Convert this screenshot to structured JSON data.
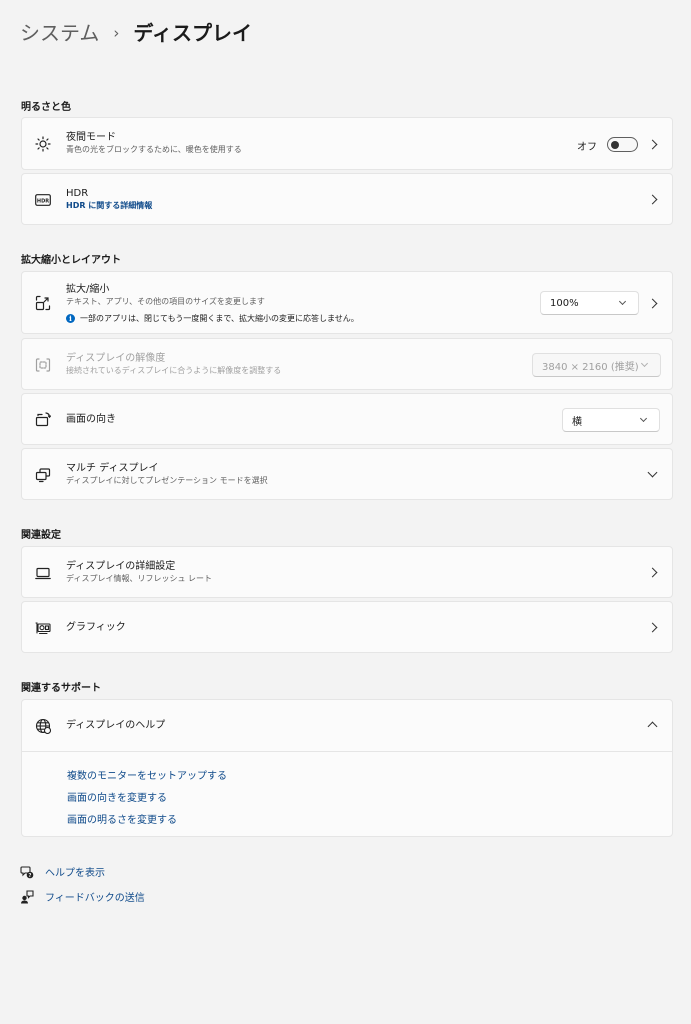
{
  "breadcrumb": {
    "parent": "システム",
    "separator": "›",
    "current": "ディスプレイ"
  },
  "sections": {
    "brightness": "明るさと色",
    "scale_layout": "拡大縮小とレイアウト",
    "related": "関連設定",
    "support": "関連するサポート"
  },
  "night_light": {
    "icon": "sun-icon",
    "title": "夜間モード",
    "subtitle": "青色の光をブロックするために、暖色を使用する",
    "state": "オフ",
    "on": false
  },
  "hdr": {
    "icon": "hdr-icon",
    "title": "HDR",
    "link": "HDR に関する詳細情報"
  },
  "scale": {
    "icon": "scale-icon",
    "title": "拡大/縮小",
    "subtitle": "テキスト、アプリ、その他の項目のサイズを変更します",
    "value": "100%",
    "info": "一部のアプリは、閉じてもう一度開くまで、拡大縮小の変更に応答しません。"
  },
  "resolution": {
    "icon": "resolution-icon",
    "title": "ディスプレイの解像度",
    "subtitle": "接続されているディスプレイに合うように解像度を調整する",
    "value": "3840 × 2160 (推奨)"
  },
  "orientation": {
    "icon": "orientation-icon",
    "title": "画面の向き",
    "value": "横"
  },
  "multi_display": {
    "icon": "multi-display-icon",
    "title": "マルチ ディスプレイ",
    "subtitle": "ディスプレイに対してプレゼンテーション モードを選択"
  },
  "advanced_display": {
    "icon": "laptop-icon",
    "title": "ディスプレイの詳細設定",
    "subtitle": "ディスプレイ情報、リフレッシュ レート"
  },
  "graphics": {
    "icon": "gpu-icon",
    "title": "グラフィック"
  },
  "display_help": {
    "icon": "globe-icon",
    "title": "ディスプレイのヘルプ",
    "links": [
      "複数のモニターをセットアップする",
      "画面の向きを変更する",
      "画面の明るさを変更する"
    ]
  },
  "footer": {
    "help": "ヘルプを表示",
    "feedback": "フィードバックの送信"
  },
  "colors": {
    "link": "#0f4a8a",
    "accent": "#0067c0",
    "background": "#f3f3f3",
    "card": "#fbfbfb"
  }
}
